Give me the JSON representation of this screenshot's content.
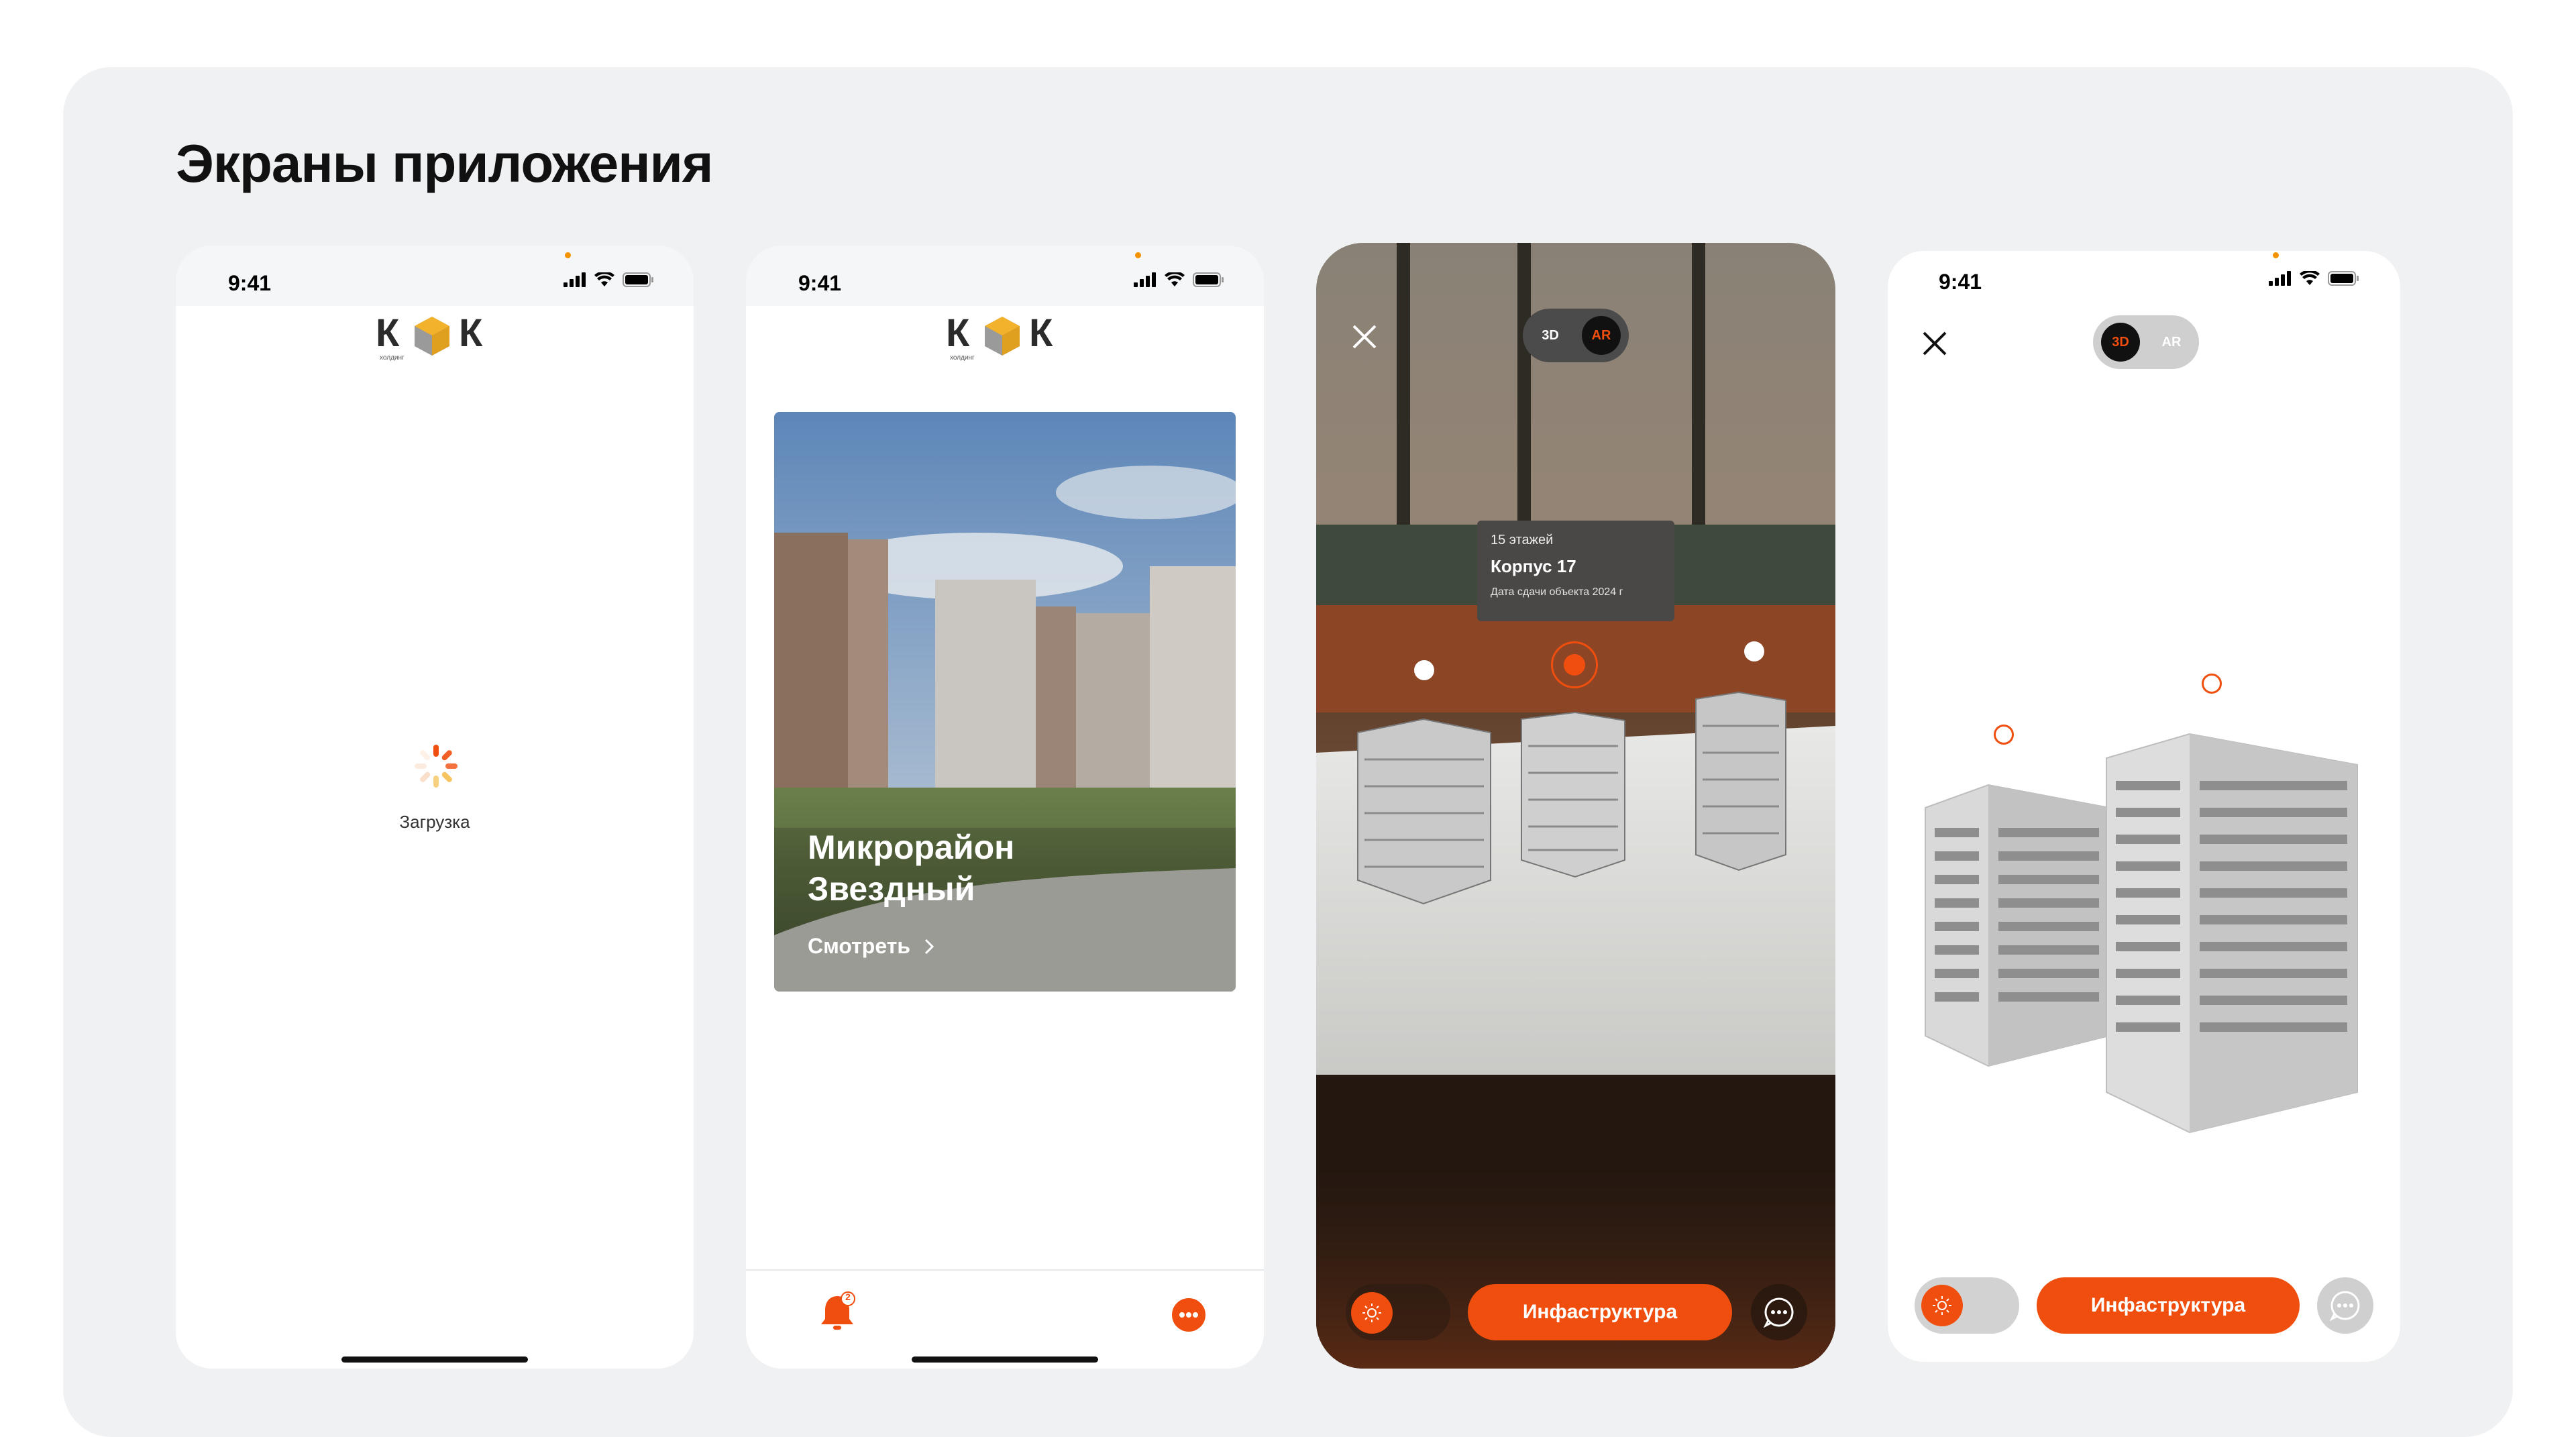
{
  "page": {
    "title": "Экраны приложения"
  },
  "colors": {
    "accent": "#f04e0e",
    "logo_gold": "#f3b22b",
    "panel": "#eff1f2"
  },
  "status_bar": {
    "time": "9:41",
    "icons": [
      "signal-icon",
      "wifi-icon",
      "battery-icon"
    ]
  },
  "logo": {
    "left": "К",
    "right": "К",
    "tagline": "холдинг"
  },
  "screen_loading": {
    "label": "Загрузка"
  },
  "screen_home": {
    "banner": {
      "title_line1": "Микрорайон",
      "title_line2": "Звездный",
      "cta": "Смотреть"
    },
    "tabbar": {
      "notifications_badge": "2",
      "icons": [
        "bell-icon",
        "chat-icon"
      ]
    }
  },
  "screen_ar": {
    "mode_3d": "3D",
    "mode_ar": "AR",
    "mode_selected": "AR",
    "tooltip": {
      "floors": "15 этажей",
      "building": "Корпус 17",
      "date": "Дата сдачи объекта 2024 г"
    },
    "infrastructure_button": "Инфаструктура"
  },
  "screen_3d": {
    "mode_3d": "3D",
    "mode_ar": "AR",
    "mode_selected": "3D",
    "infrastructure_button": "Инфаструктура"
  }
}
